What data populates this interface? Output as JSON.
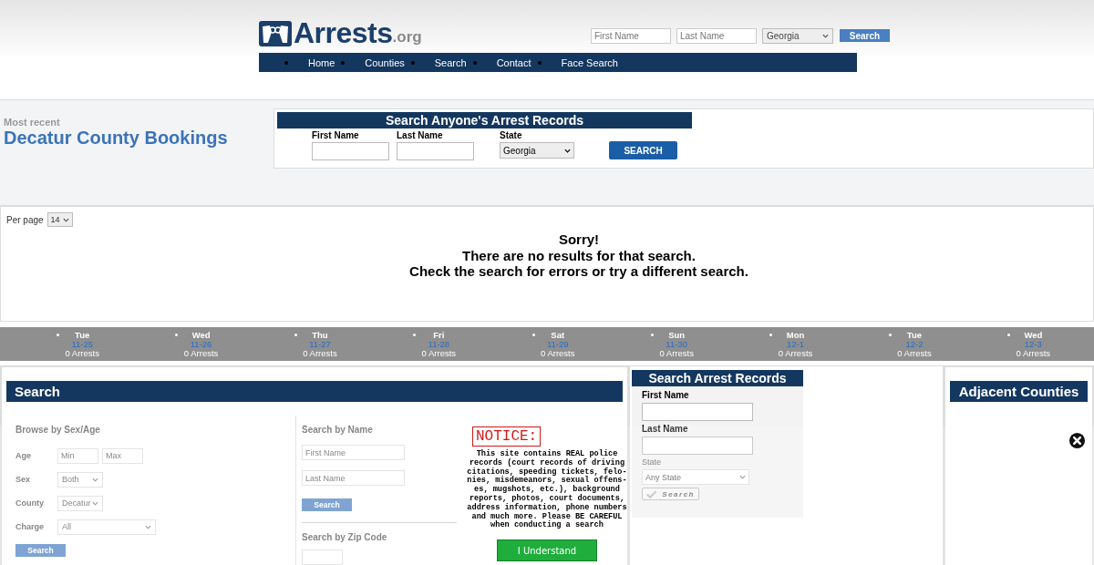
{
  "header": {
    "logo": {
      "name": "Arrests",
      "suffix": ".org"
    },
    "search": {
      "first_name_placeholder": "First Name",
      "last_name_placeholder": "Last Name",
      "state": "Georgia",
      "button": "Search"
    }
  },
  "nav": [
    {
      "label": "Home"
    },
    {
      "label": "Counties"
    },
    {
      "label": "Search"
    },
    {
      "label": "Contact"
    },
    {
      "label": "Face Search"
    }
  ],
  "bookings": {
    "kicker": "Most recent",
    "title": "Decatur County Bookings"
  },
  "records_search": {
    "title": "Search Anyone's Arrest Records",
    "fields": [
      {
        "label": "First Name",
        "kind": "text"
      },
      {
        "label": "Last Name",
        "kind": "text"
      },
      {
        "label": "State",
        "kind": "select",
        "value": "Georgia"
      }
    ],
    "button": "SEARCH"
  },
  "results": {
    "per_page_label": "Per page",
    "per_page": "14",
    "message": [
      "Sorry!",
      "There are no results for that search.",
      "Check the search for errors or try a different search."
    ]
  },
  "days": [
    {
      "day": "Tue",
      "date": "11-25",
      "count": "0 Arrests"
    },
    {
      "day": "Wed",
      "date": "11-26",
      "count": "0 Arrests"
    },
    {
      "day": "Thu",
      "date": "11-27",
      "count": "0 Arrests"
    },
    {
      "day": "Fri",
      "date": "11-28",
      "count": "0 Arrests"
    },
    {
      "day": "Sat",
      "date": "11-29",
      "count": "0 Arrests"
    },
    {
      "day": "Sun",
      "date": "11-30",
      "count": "0 Arrests"
    },
    {
      "day": "Mon",
      "date": "12-1",
      "count": "0 Arrests"
    },
    {
      "day": "Tue",
      "date": "12-2",
      "count": "0 Arrests"
    },
    {
      "day": "Wed",
      "date": "12-3",
      "count": "0 Arrests"
    }
  ],
  "search_panel": {
    "title": "Search",
    "browse": {
      "title": "Browse by Sex/Age",
      "rows": [
        {
          "label": "Age",
          "kind": "range",
          "min_placeholder": "Min",
          "max_placeholder": "Max"
        },
        {
          "label": "Sex",
          "kind": "select",
          "value": "Both"
        },
        {
          "label": "County",
          "kind": "select",
          "value": "Decatur"
        },
        {
          "label": "Charge",
          "kind": "select",
          "value": "All",
          "wide": true
        }
      ],
      "button": "Search"
    },
    "by_name": {
      "title": "Search by Name",
      "placeholders": [
        "First Name",
        "Last Name"
      ],
      "button": "Search"
    },
    "by_zip": {
      "title": "Search by Zip Code"
    }
  },
  "arrest_records": {
    "title": "Search Arrest Records",
    "fields": [
      {
        "label": "First Name",
        "kind": "text"
      },
      {
        "label": "Last Name",
        "kind": "text"
      },
      {
        "label": "State",
        "kind": "select",
        "value": "Any State"
      }
    ],
    "button": "Search"
  },
  "adjacent": {
    "title": "Adjacent Counties"
  },
  "notice": {
    "title": "NOTICE:",
    "text": "This site contains REAL police records (court records of driving citations, speeding tickets, felo-nies, misdemeanors, sexual offens-es, mugshots, etc.), background reports, photos, court documents, address information, phone numbers and much more. Please BE CAREFUL when conducting a search",
    "button": "I Understand"
  }
}
